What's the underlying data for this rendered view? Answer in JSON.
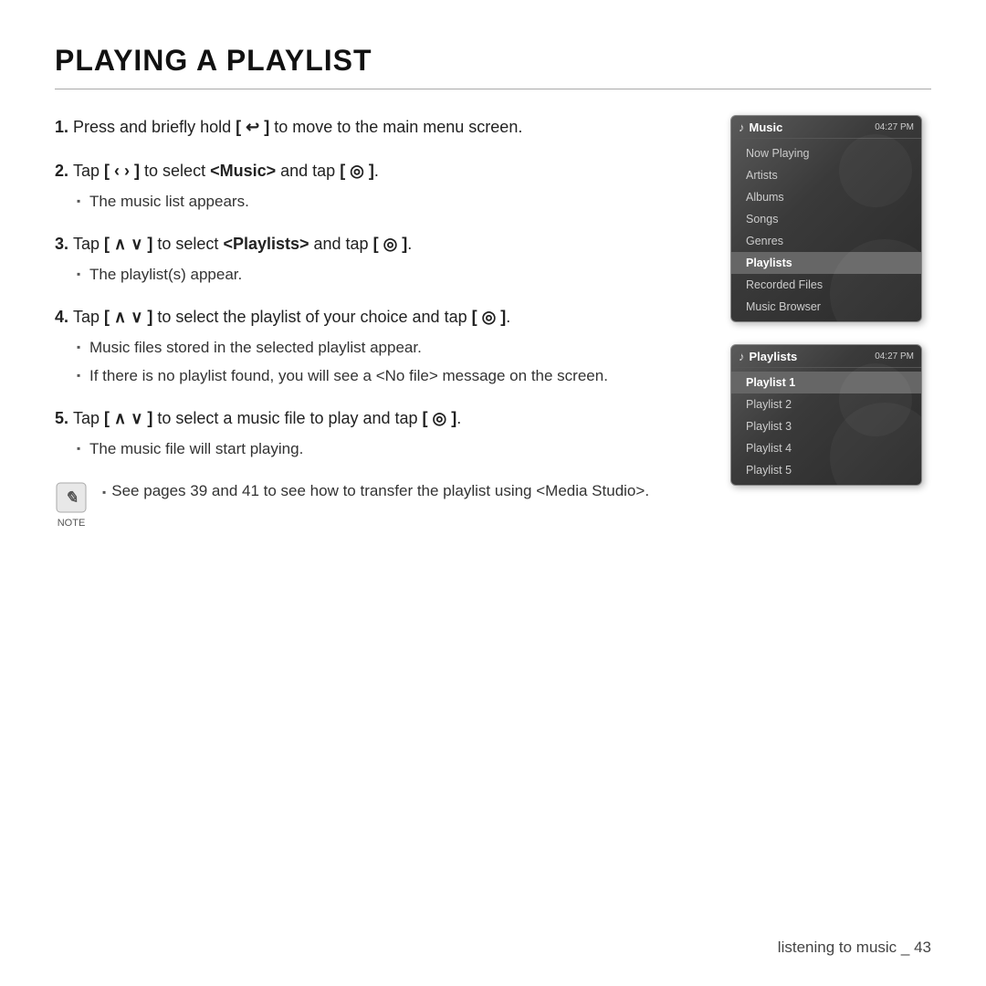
{
  "page": {
    "title": "PLAYING A PLAYLIST",
    "footer": "listening to music _ 43"
  },
  "steps": [
    {
      "number": "1.",
      "text": "Press and briefly hold [ ↩ ] to move to the main menu screen."
    },
    {
      "number": "2.",
      "text": "Tap [ ‹ › ] to select <Music> and tap [ ◎ ].",
      "bullets": [
        "The music list appears."
      ]
    },
    {
      "number": "3.",
      "text": "Tap [ ∧ ∨ ] to select <Playlists> and tap [ ◎ ].",
      "bullets": [
        "The playlist(s) appear."
      ]
    },
    {
      "number": "4.",
      "text": "Tap [ ∧ ∨ ] to select the playlist of your choice and tap [ ◎ ].",
      "bullets": [
        "Music files stored in the selected playlist appear.",
        "If there is no playlist found, you will see a <No file> message on the screen."
      ]
    },
    {
      "number": "5.",
      "text": "Tap [ ∧ ∨ ] to select a music file to play and tap [ ◎ ].",
      "bullets": [
        "The music file will start playing."
      ]
    }
  ],
  "note": {
    "label": "NOTE",
    "text": "See pages 39 and 41 to see how to transfer the playlist using <Media Studio>."
  },
  "screen1": {
    "header_icon": "♪",
    "title": "Music",
    "time": "04:27 PM",
    "items": [
      {
        "label": "Now Playing",
        "active": false
      },
      {
        "label": "Artists",
        "active": false
      },
      {
        "label": "Albums",
        "active": false
      },
      {
        "label": "Songs",
        "active": false
      },
      {
        "label": "Genres",
        "active": false
      },
      {
        "label": "Playlists",
        "active": true
      },
      {
        "label": "Recorded Files",
        "active": false
      },
      {
        "label": "Music Browser",
        "active": false
      }
    ]
  },
  "screen2": {
    "header_icon": "♪",
    "title": "Playlists",
    "time": "04:27 PM",
    "items": [
      {
        "label": "Playlist 1",
        "active": true
      },
      {
        "label": "Playlist 2",
        "active": false
      },
      {
        "label": "Playlist 3",
        "active": false
      },
      {
        "label": "Playlist 4",
        "active": false
      },
      {
        "label": "Playlist 5",
        "active": false
      }
    ]
  }
}
